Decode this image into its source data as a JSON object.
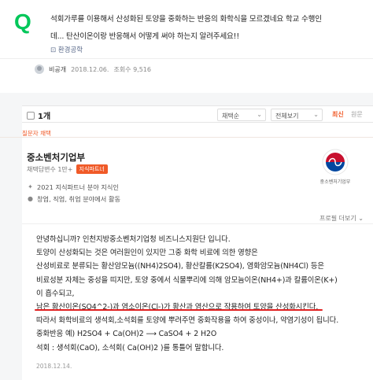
{
  "question": {
    "q_letter": "Q",
    "line1": "석회가루를 이용해서 산성화된 토양을 중화하는 반응의 화학식을 모르겠네요 학교 수행인",
    "line2": "데... 탄산이온이랑 반응해서 어떻게 써야 하는지 알려주세요!!",
    "tag": "⊡ 환경공학",
    "author": "비공개",
    "date": "2018.12.06.",
    "views": "조회수 9,516"
  },
  "answer_bar": {
    "count": "1개",
    "filter1": "채택순",
    "filter2": "전체보기",
    "sort_latest": "최신",
    "sort_original": "원문"
  },
  "answer": {
    "picked_label": "질문자 채택",
    "expert_name": "중소벤처기업부",
    "expert_sub": "채택답변수 1만+",
    "expert_badge": "지식파트너",
    "gov_text": "중소벤처기업부",
    "info": [
      {
        "icon": "✦",
        "text": "2021 지식파트너 분야 지식인"
      },
      {
        "icon": "●",
        "text": "창업, 직업, 취업 분야에서 활동"
      }
    ],
    "profile_more": "프로필 더보기 ⌄",
    "lines": [
      "안녕하십니까? 인천지방중소벤처기업청 비즈니스지원단 입니다.",
      "토양이 산성화되는 것은 여러원인이 있지만 그중 화학 비료에 의한 영향은",
      " 산성비료로 분류되는 황산암모늄((NH4)2SO4), 황산칼륨(K2SO4), 염화암모늄(NH4Cl) 등은",
      "비료성분 자체는 중성을 띠지만, 토양 중에서 식물뿌리에 의해 암모늄이온(NH4+)과 칼륨이온(K+)",
      "이 흡수되고,"
    ],
    "highlight_line": "남은 황산이온(SO4^2-)과 염소이온(Cl-)가 황산과 염산으로 작용하여 토양을 산성화시킨다.",
    "lines2": [
      "따라서 화학비료의 생석회,소석회를 토양에 뿌려주면 중화작용을 하여 중성이나, 약염기성이 됩니다.",
      "중화반응 예) H2SO4 + Ca(OH)2 ⟶ CaSO4 + 2 H2O",
      "석회 : 생석회(CaO), 소석회( Ca(OH)2 )를 통틀어 말합니다."
    ],
    "date": "2018.12.14."
  }
}
